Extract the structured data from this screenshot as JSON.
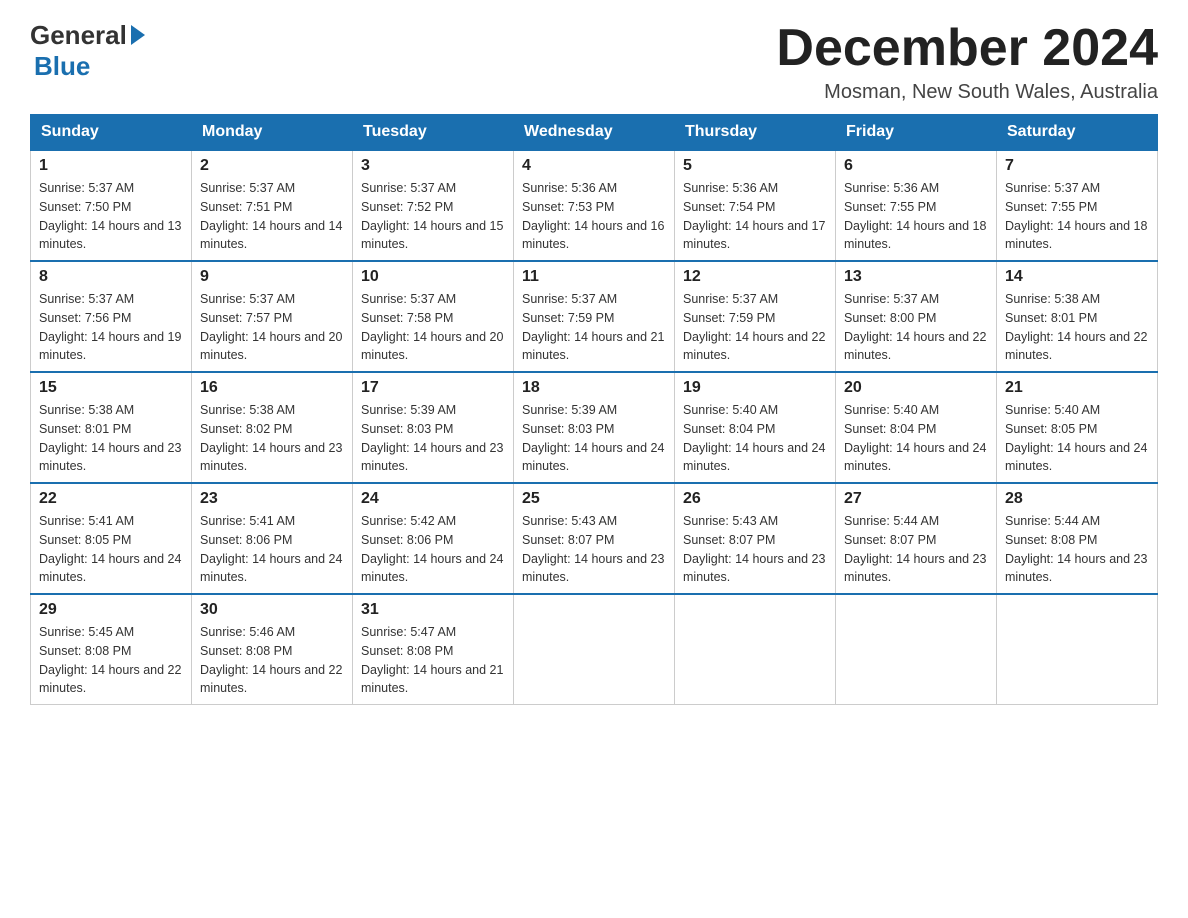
{
  "header": {
    "logo_general": "General",
    "logo_blue": "Blue",
    "month_title": "December 2024",
    "location": "Mosman, New South Wales, Australia"
  },
  "weekdays": [
    "Sunday",
    "Monday",
    "Tuesday",
    "Wednesday",
    "Thursday",
    "Friday",
    "Saturday"
  ],
  "weeks": [
    [
      {
        "day": "1",
        "sunrise": "5:37 AM",
        "sunset": "7:50 PM",
        "daylight": "14 hours and 13 minutes."
      },
      {
        "day": "2",
        "sunrise": "5:37 AM",
        "sunset": "7:51 PM",
        "daylight": "14 hours and 14 minutes."
      },
      {
        "day": "3",
        "sunrise": "5:37 AM",
        "sunset": "7:52 PM",
        "daylight": "14 hours and 15 minutes."
      },
      {
        "day": "4",
        "sunrise": "5:36 AM",
        "sunset": "7:53 PM",
        "daylight": "14 hours and 16 minutes."
      },
      {
        "day": "5",
        "sunrise": "5:36 AM",
        "sunset": "7:54 PM",
        "daylight": "14 hours and 17 minutes."
      },
      {
        "day": "6",
        "sunrise": "5:36 AM",
        "sunset": "7:55 PM",
        "daylight": "14 hours and 18 minutes."
      },
      {
        "day": "7",
        "sunrise": "5:37 AM",
        "sunset": "7:55 PM",
        "daylight": "14 hours and 18 minutes."
      }
    ],
    [
      {
        "day": "8",
        "sunrise": "5:37 AM",
        "sunset": "7:56 PM",
        "daylight": "14 hours and 19 minutes."
      },
      {
        "day": "9",
        "sunrise": "5:37 AM",
        "sunset": "7:57 PM",
        "daylight": "14 hours and 20 minutes."
      },
      {
        "day": "10",
        "sunrise": "5:37 AM",
        "sunset": "7:58 PM",
        "daylight": "14 hours and 20 minutes."
      },
      {
        "day": "11",
        "sunrise": "5:37 AM",
        "sunset": "7:59 PM",
        "daylight": "14 hours and 21 minutes."
      },
      {
        "day": "12",
        "sunrise": "5:37 AM",
        "sunset": "7:59 PM",
        "daylight": "14 hours and 22 minutes."
      },
      {
        "day": "13",
        "sunrise": "5:37 AM",
        "sunset": "8:00 PM",
        "daylight": "14 hours and 22 minutes."
      },
      {
        "day": "14",
        "sunrise": "5:38 AM",
        "sunset": "8:01 PM",
        "daylight": "14 hours and 22 minutes."
      }
    ],
    [
      {
        "day": "15",
        "sunrise": "5:38 AM",
        "sunset": "8:01 PM",
        "daylight": "14 hours and 23 minutes."
      },
      {
        "day": "16",
        "sunrise": "5:38 AM",
        "sunset": "8:02 PM",
        "daylight": "14 hours and 23 minutes."
      },
      {
        "day": "17",
        "sunrise": "5:39 AM",
        "sunset": "8:03 PM",
        "daylight": "14 hours and 23 minutes."
      },
      {
        "day": "18",
        "sunrise": "5:39 AM",
        "sunset": "8:03 PM",
        "daylight": "14 hours and 24 minutes."
      },
      {
        "day": "19",
        "sunrise": "5:40 AM",
        "sunset": "8:04 PM",
        "daylight": "14 hours and 24 minutes."
      },
      {
        "day": "20",
        "sunrise": "5:40 AM",
        "sunset": "8:04 PM",
        "daylight": "14 hours and 24 minutes."
      },
      {
        "day": "21",
        "sunrise": "5:40 AM",
        "sunset": "8:05 PM",
        "daylight": "14 hours and 24 minutes."
      }
    ],
    [
      {
        "day": "22",
        "sunrise": "5:41 AM",
        "sunset": "8:05 PM",
        "daylight": "14 hours and 24 minutes."
      },
      {
        "day": "23",
        "sunrise": "5:41 AM",
        "sunset": "8:06 PM",
        "daylight": "14 hours and 24 minutes."
      },
      {
        "day": "24",
        "sunrise": "5:42 AM",
        "sunset": "8:06 PM",
        "daylight": "14 hours and 24 minutes."
      },
      {
        "day": "25",
        "sunrise": "5:43 AM",
        "sunset": "8:07 PM",
        "daylight": "14 hours and 23 minutes."
      },
      {
        "day": "26",
        "sunrise": "5:43 AM",
        "sunset": "8:07 PM",
        "daylight": "14 hours and 23 minutes."
      },
      {
        "day": "27",
        "sunrise": "5:44 AM",
        "sunset": "8:07 PM",
        "daylight": "14 hours and 23 minutes."
      },
      {
        "day": "28",
        "sunrise": "5:44 AM",
        "sunset": "8:08 PM",
        "daylight": "14 hours and 23 minutes."
      }
    ],
    [
      {
        "day": "29",
        "sunrise": "5:45 AM",
        "sunset": "8:08 PM",
        "daylight": "14 hours and 22 minutes."
      },
      {
        "day": "30",
        "sunrise": "5:46 AM",
        "sunset": "8:08 PM",
        "daylight": "14 hours and 22 minutes."
      },
      {
        "day": "31",
        "sunrise": "5:47 AM",
        "sunset": "8:08 PM",
        "daylight": "14 hours and 21 minutes."
      },
      null,
      null,
      null,
      null
    ]
  ]
}
